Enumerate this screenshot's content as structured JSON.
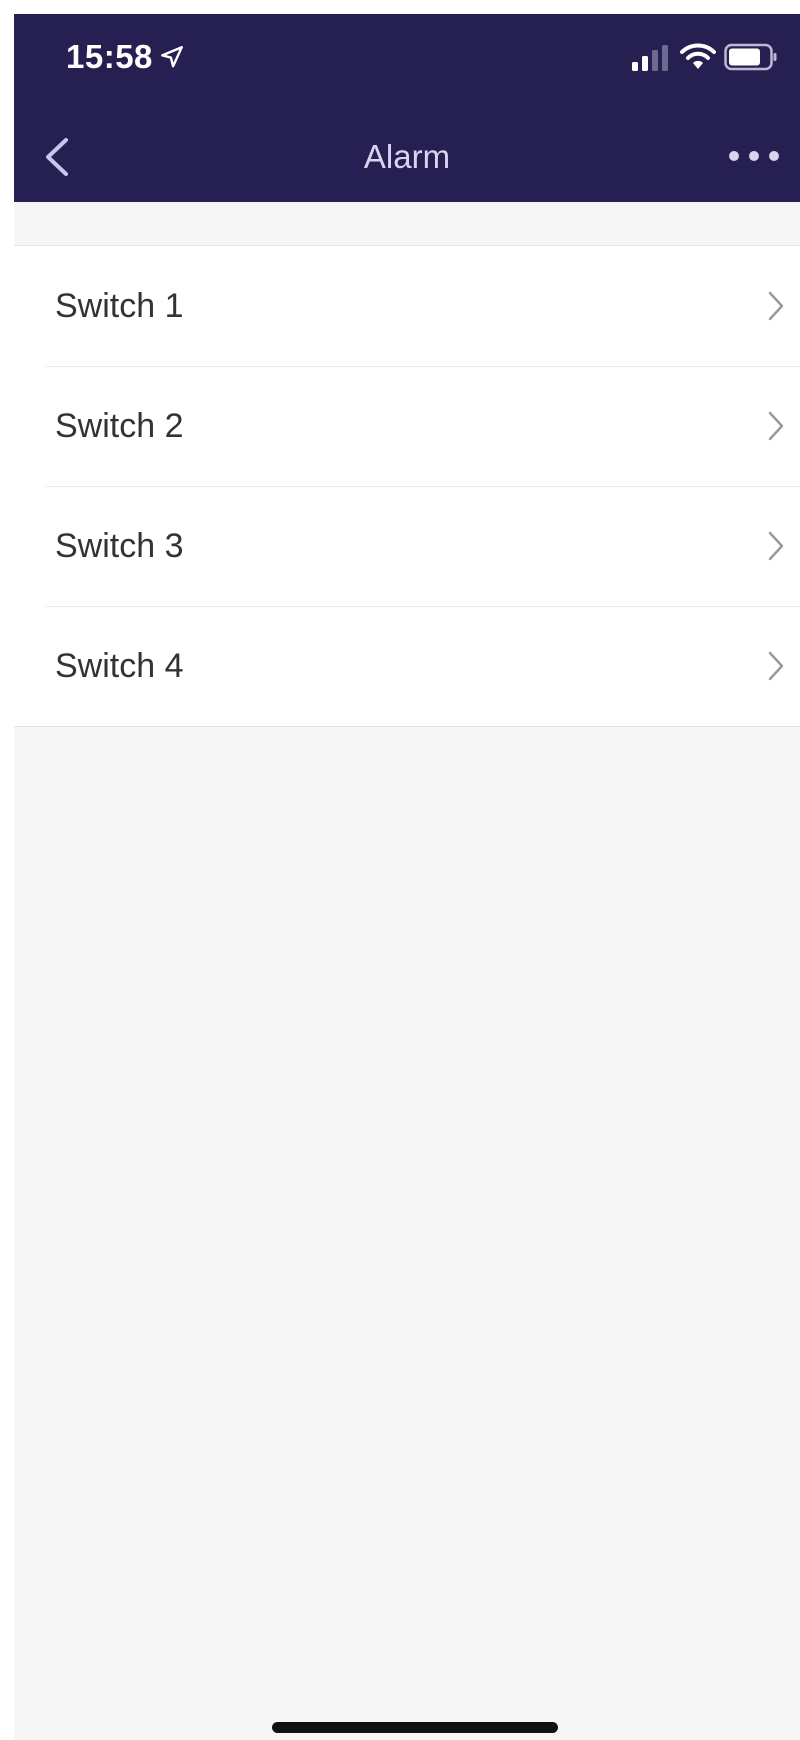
{
  "status_bar": {
    "time": "15:58",
    "icons": [
      "location-arrow-icon",
      "signal-icon",
      "wifi-icon",
      "battery-icon"
    ]
  },
  "nav_bar": {
    "title": "Alarm",
    "back_icon": "chevron-left-icon",
    "more_icon": "more-horizontal-icon"
  },
  "list": {
    "items": [
      {
        "label": "Switch 1"
      },
      {
        "label": "Switch 2"
      },
      {
        "label": "Switch 3"
      },
      {
        "label": "Switch 4"
      }
    ]
  },
  "colors": {
    "header_bg": "#261f52",
    "title": "#d8d4f0",
    "page_bg": "#f6f6f6",
    "row_text": "#333333",
    "chevron": "#9a9a9a"
  }
}
